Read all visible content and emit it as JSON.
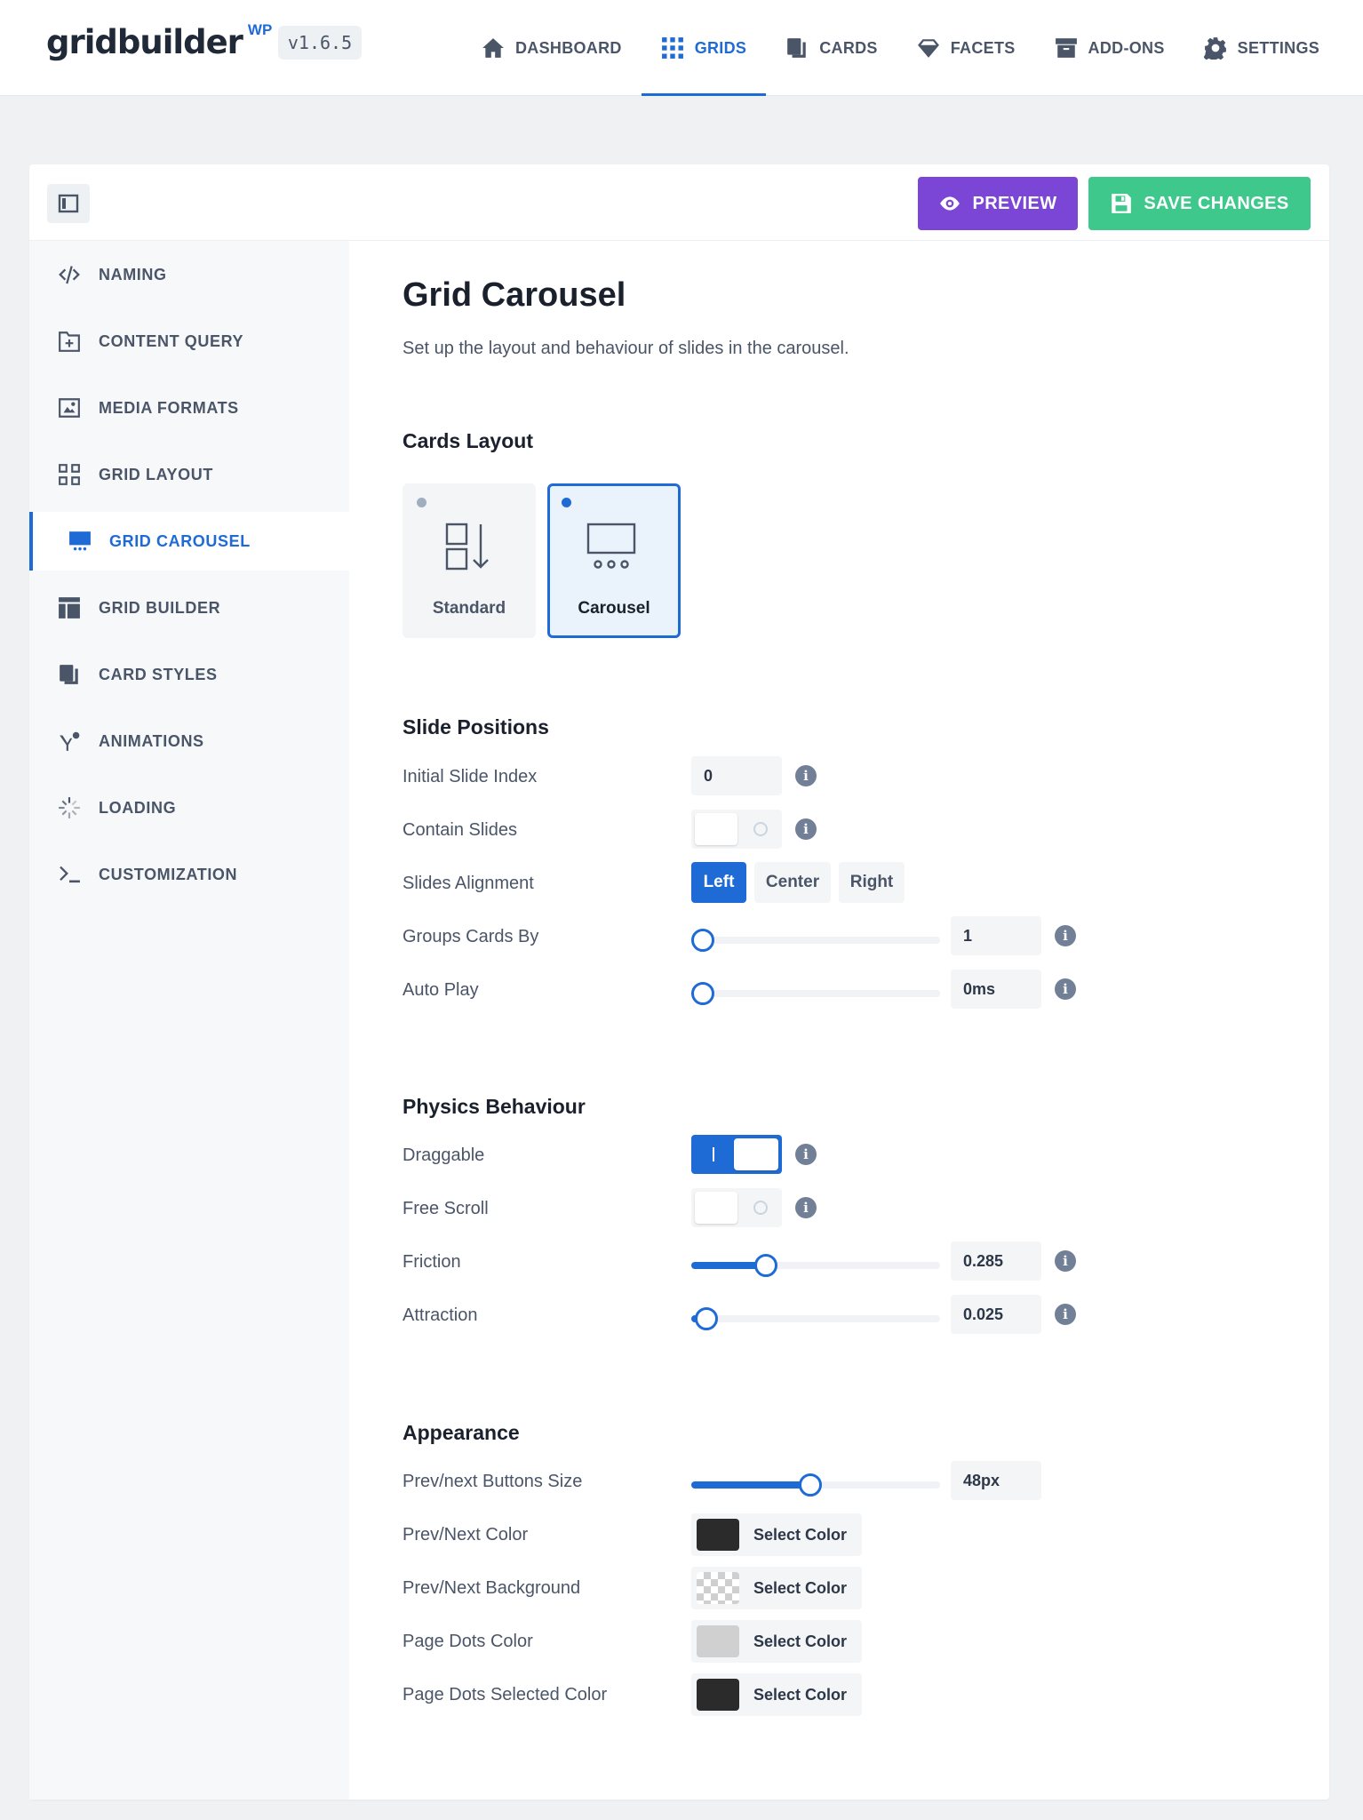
{
  "app": {
    "logo_text": "gridbuilder",
    "logo_suffix": "WP",
    "version": "v1.6.5"
  },
  "nav": [
    {
      "label": "DASHBOARD",
      "icon": "home-icon",
      "active": false
    },
    {
      "label": "GRIDS",
      "icon": "grid-dots-icon",
      "active": true
    },
    {
      "label": "CARDS",
      "icon": "cards-icon",
      "active": false
    },
    {
      "label": "FACETS",
      "icon": "diamond-icon",
      "active": false
    },
    {
      "label": "ADD-ONS",
      "icon": "box-icon",
      "active": false
    },
    {
      "label": "SETTINGS",
      "icon": "gear-icon",
      "active": false
    }
  ],
  "toolbar": {
    "preview_label": "PREVIEW",
    "save_label": "SAVE CHANGES"
  },
  "sidebar": [
    {
      "label": "NAMING",
      "icon": "code-icon"
    },
    {
      "label": "CONTENT QUERY",
      "icon": "folder-plus-icon"
    },
    {
      "label": "MEDIA FORMATS",
      "icon": "image-icon"
    },
    {
      "label": "GRID LAYOUT",
      "icon": "layout-grid-icon"
    },
    {
      "label": "GRID CAROUSEL",
      "icon": "carousel-icon",
      "active": true
    },
    {
      "label": "GRID BUILDER",
      "icon": "builder-icon"
    },
    {
      "label": "CARD STYLES",
      "icon": "card-styles-icon"
    },
    {
      "label": "ANIMATIONS",
      "icon": "animation-icon"
    },
    {
      "label": "LOADING",
      "icon": "spinner-icon"
    },
    {
      "label": "CUSTOMIZATION",
      "icon": "terminal-icon"
    }
  ],
  "page": {
    "title": "Grid Carousel",
    "description": "Set up the layout and behaviour of slides in the carousel."
  },
  "cards_layout": {
    "title": "Cards Layout",
    "options": [
      {
        "label": "Standard",
        "selected": false
      },
      {
        "label": "Carousel",
        "selected": true
      }
    ]
  },
  "slide_positions": {
    "title": "Slide Positions",
    "initial_slide_index": {
      "label": "Initial Slide Index",
      "value": "0"
    },
    "contain_slides": {
      "label": "Contain Slides",
      "on": false
    },
    "slides_alignment": {
      "label": "Slides Alignment",
      "options": [
        "Left",
        "Center",
        "Right"
      ],
      "selected": "Left"
    },
    "group_cards_by": {
      "label": "Groups Cards By",
      "value": "1",
      "level": 0
    },
    "auto_play": {
      "label": "Auto Play",
      "value": "0ms",
      "level": 0
    }
  },
  "physics": {
    "title": "Physics Behaviour",
    "draggable": {
      "label": "Draggable",
      "on": true
    },
    "free_scroll": {
      "label": "Free Scroll",
      "on": false
    },
    "friction": {
      "label": "Friction",
      "value": "0.285",
      "level": 0.3
    },
    "attraction": {
      "label": "Attraction",
      "value": "0.025",
      "level": 0.06
    }
  },
  "appearance": {
    "title": "Appearance",
    "buttons_size": {
      "label": "Prev/next Buttons Size",
      "value": "48px",
      "level": 0.48
    },
    "colors": [
      {
        "label": "Prev/Next Color",
        "button": "Select Color",
        "swatch": "#2b2b2b"
      },
      {
        "label": "Prev/Next Background",
        "button": "Select Color",
        "swatch": "transparent"
      },
      {
        "label": "Page Dots Color",
        "button": "Select Color",
        "swatch": "#d0d0d0"
      },
      {
        "label": "Page Dots Selected Color",
        "button": "Select Color",
        "swatch": "#2b2b2b"
      }
    ]
  },
  "theme": {
    "accent": "#1f6bd6",
    "preview": "#7b45d6",
    "save": "#3ec88b"
  }
}
